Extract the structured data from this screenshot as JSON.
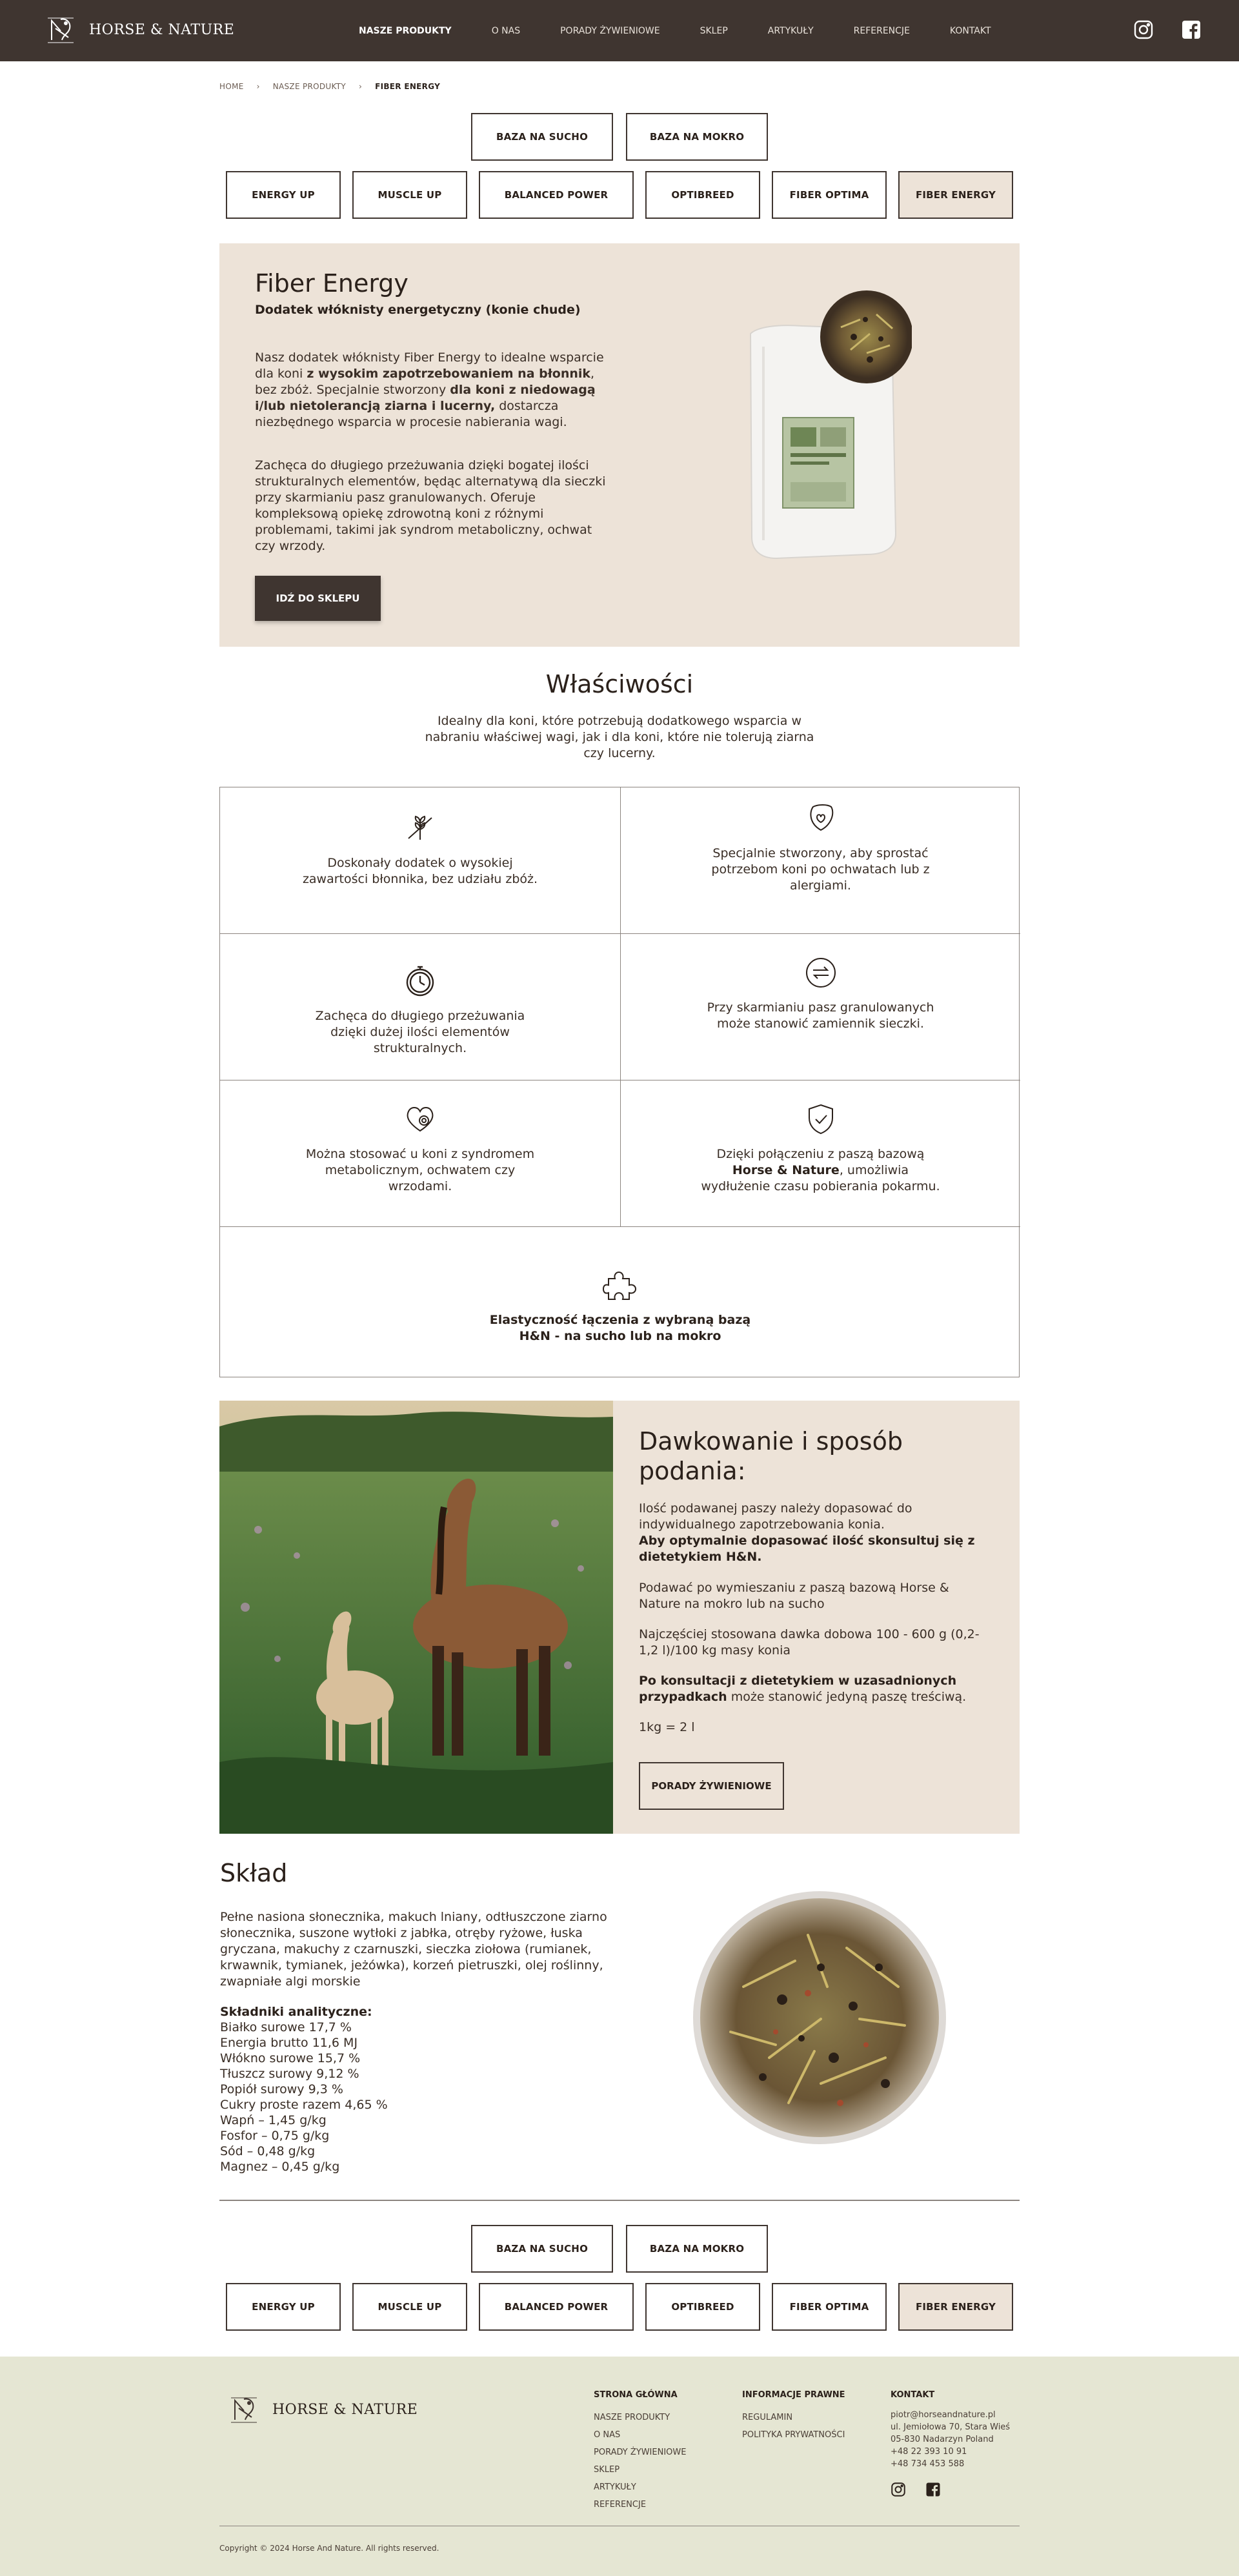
{
  "header": {
    "brand": "HORSE & NATURE",
    "nav": [
      {
        "label": "NASZE PRODUKTY",
        "active": true
      },
      {
        "label": "O NAS",
        "active": false
      },
      {
        "label": "PORADY ŻYWIENIOWE",
        "active": false
      },
      {
        "label": "SKLEP",
        "active": false
      },
      {
        "label": "ARTYKUŁY",
        "active": false
      },
      {
        "label": "REFERENCJE",
        "active": false
      },
      {
        "label": "KONTAKT",
        "active": false
      }
    ],
    "social_icons": [
      "instagram-icon",
      "facebook-icon"
    ]
  },
  "breadcrumb": [
    "HOME",
    "NASZE PRODUKTY",
    "FIBER ENERGY"
  ],
  "base_tabs": [
    "BAZA NA SUCHO",
    "BAZA NA MOKRO"
  ],
  "product_tabs": [
    {
      "label": "ENERGY UP",
      "active": false
    },
    {
      "label": "MUSCLE UP",
      "active": false
    },
    {
      "label": "BALANCED POWER",
      "active": false
    },
    {
      "label": "OPTIBREED",
      "active": false
    },
    {
      "label": "FIBER OPTIMA",
      "active": false
    },
    {
      "label": "FIBER ENERGY",
      "active": true
    }
  ],
  "hero": {
    "title": "Fiber Energy",
    "subtitle": "Dodatek włóknisty energetyczny (konie chude)",
    "p1_a": "Nasz dodatek włóknisty Fiber Energy to idealne wsparcie dla koni ",
    "p1_b": "z wysokim zapotrzebowaniem na błonnik",
    "p1_c": ", bez zbóż. Specjalnie stworzony ",
    "p1_d": "dla koni z niedowagą i/lub nietolerancją ziarna i lucerny,",
    "p1_e": " dostarcza niezbędnego wsparcia w procesie nabierania wagi.",
    "p2": "Zachęca do długiego przeżuwania dzięki bogatej ilości strukturalnych elementów, będąc alternatywą dla sieczki przy skarmianiu pasz granulowanych. Oferuje kompleksową opiekę zdrowotną koni z różnymi problemami, takimi jak syndrom metaboliczny, ochwat czy wrzody.",
    "button": "IDŹ DO SKLEPU"
  },
  "properties": {
    "title": "Właściwości",
    "intro": "Idealny dla koni, które potrzebują dodatkowego wsparcia w nabraniu właściwej wagi, jak i dla koni, które nie tolerują ziarna czy lucerny.",
    "items": [
      {
        "icon": "no-grain-icon",
        "text": "Doskonały dodatek o wysokiej zawartości błonnika, bez udziału zbóż."
      },
      {
        "icon": "leaf-heart-icon",
        "text": "Specjalnie stworzony, aby sprostać potrzebom koni po ochwatach lub z alergiami."
      },
      {
        "icon": "stopwatch-icon",
        "text": "Zachęca do długiego przeżuwania dzięki dużej ilości elementów strukturalnych."
      },
      {
        "icon": "swap-arrows-icon",
        "text": "Przy skarmianiu pasz granulowanych może stanowić zamiennik sieczki."
      },
      {
        "icon": "heart-gear-icon",
        "text": "Można stosować u koni z syndromem metabolicznym, ochwatem czy wrzodami."
      },
      {
        "icon": "shield-check-icon",
        "text_a": "Dzięki połączeniu z paszą bazową ",
        "text_b": "Horse & Nature",
        "text_c": ", umożliwia wydłużenie czasu pobierania pokarmu."
      },
      {
        "icon": "puzzle-icon",
        "text": "Elastyczność łączenia z wybraną bazą H&N - na sucho lub na mokro"
      }
    ]
  },
  "dosing": {
    "title": "Dawkowanie i sposób podania:",
    "p1": "Ilość podawanej paszy należy dopasować do indywidualnego zapotrzebowania konia.",
    "p1_bold": "Aby optymalnie dopasować ilość skonsultuj się z dietetykiem H&N.",
    "p2": "Podawać po wymieszaniu z paszą bazową Horse & Nature na mokro lub na sucho",
    "p3": "Najczęściej stosowana dawka dobowa  100 - 600 g (0,2-1,2 l)/100 kg masy konia",
    "p4_bold": "Po konsultacji z dietetykiem w uzasadnionych przypadkach",
    "p4_rest": " może stanowić jedyną paszę treściwą.",
    "p5": "1kg = 2 l",
    "button": "PORADY ŻYWIENIOWE"
  },
  "composition": {
    "title": "Skład",
    "text": "Pełne nasiona słonecznika, makuch lniany, odtłuszczone ziarno słonecznika, suszone wytłoki z jabłka, otręby ryżowe, łuska gryczana, makuchy z czarnuszki, sieczka ziołowa (rumianek, krwawnik, tymianek, jeżówka), korzeń pietruszki, olej roślinny, zwapniałe algi morskie",
    "analytical_heading": "Składniki analityczne:",
    "analytical": [
      "Białko surowe 17,7 %",
      "Energia brutto 11,6 MJ",
      "Włókno surowe 15,7 %",
      "Tłuszcz surowy 9,12 %",
      "Popiół surowy 9,3 %",
      "Cukry proste razem  4,65 %",
      "Wapń – 1,45 g/kg",
      "Fosfor – 0,75 g/kg",
      "Sód – 0,48 g/kg",
      "Magnez – 0,45 g/kg"
    ]
  },
  "footer": {
    "brand": "HORSE & NATURE",
    "col1_title": "STRONA GŁÓWNA",
    "col1_links": [
      "NASZE PRODUKTY",
      "O NAS",
      "PORADY ŻYWIENIOWE",
      "SKLEP",
      "ARTYKUŁY",
      "REFERENCJE"
    ],
    "col2_title": "INFORMACJE PRAWNE",
    "col2_links": [
      "REGULAMIN",
      "POLITYKA PRYWATNOŚCI"
    ],
    "col3_title": "KONTAKT",
    "contact": [
      "piotr@horseandnature.pl",
      "ul. Jemiołowa 70, Stara Wieś",
      "05-830 Nadarzyn Poland",
      "+48 22 393 10 91",
      "+48 734 453 588"
    ],
    "copyright": "Copyright © 2024 Horse And Nature. All rights reserved."
  },
  "colors": {
    "header": "#3f3530",
    "beige": "#ede3d8",
    "footer": "#e5e6d3"
  }
}
